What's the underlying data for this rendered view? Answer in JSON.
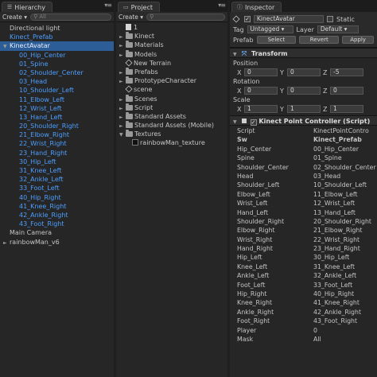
{
  "hierarchy": {
    "tab_label": "Hierarchy",
    "create_label": "Create",
    "search_placeholder": "All",
    "items": [
      {
        "label": "Directional light",
        "indent": 0,
        "blue": false,
        "arrow": ""
      },
      {
        "label": "Kinect_Prefab",
        "indent": 0,
        "blue": true,
        "arrow": ""
      },
      {
        "label": "KinectAvatar",
        "indent": 0,
        "blue": false,
        "arrow": "▼",
        "selected": true
      },
      {
        "label": "00_Hip_Center",
        "indent": 2,
        "blue": true,
        "arrow": ""
      },
      {
        "label": "01_Spine",
        "indent": 2,
        "blue": true,
        "arrow": ""
      },
      {
        "label": "02_Shoulder_Center",
        "indent": 2,
        "blue": true,
        "arrow": ""
      },
      {
        "label": "03_Head",
        "indent": 2,
        "blue": true,
        "arrow": ""
      },
      {
        "label": "10_Shoulder_Left",
        "indent": 2,
        "blue": true,
        "arrow": ""
      },
      {
        "label": "11_Elbow_Left",
        "indent": 2,
        "blue": true,
        "arrow": ""
      },
      {
        "label": "12_Wrist_Left",
        "indent": 2,
        "blue": true,
        "arrow": ""
      },
      {
        "label": "13_Hand_Left",
        "indent": 2,
        "blue": true,
        "arrow": ""
      },
      {
        "label": "20_Shoulder_Right",
        "indent": 2,
        "blue": true,
        "arrow": ""
      },
      {
        "label": "21_Elbow_Right",
        "indent": 2,
        "blue": true,
        "arrow": ""
      },
      {
        "label": "22_Wrist_Right",
        "indent": 2,
        "blue": true,
        "arrow": ""
      },
      {
        "label": "23_Hand_Right",
        "indent": 2,
        "blue": true,
        "arrow": ""
      },
      {
        "label": "30_Hip_Left",
        "indent": 2,
        "blue": true,
        "arrow": ""
      },
      {
        "label": "31_Knee_Left",
        "indent": 2,
        "blue": true,
        "arrow": ""
      },
      {
        "label": "32_Ankle_Left",
        "indent": 2,
        "blue": true,
        "arrow": ""
      },
      {
        "label": "33_Foot_Left",
        "indent": 2,
        "blue": true,
        "arrow": ""
      },
      {
        "label": "40_Hip_Right",
        "indent": 2,
        "blue": true,
        "arrow": ""
      },
      {
        "label": "41_Knee_Right",
        "indent": 2,
        "blue": true,
        "arrow": ""
      },
      {
        "label": "42_Ankle_Right",
        "indent": 2,
        "blue": true,
        "arrow": ""
      },
      {
        "label": "43_Foot_Right",
        "indent": 2,
        "blue": true,
        "arrow": ""
      },
      {
        "label": "Main Camera",
        "indent": 0,
        "blue": false,
        "arrow": ""
      },
      {
        "label": "rainbowMan_v6",
        "indent": 0,
        "blue": false,
        "arrow": "►"
      }
    ]
  },
  "project": {
    "tab_label": "Project",
    "create_label": "Create",
    "search_placeholder": "",
    "items": [
      {
        "label": "1",
        "kind": "file",
        "indent": 0,
        "arrow": ""
      },
      {
        "label": "Kinect",
        "kind": "folder",
        "indent": 0,
        "arrow": "►"
      },
      {
        "label": "Materials",
        "kind": "folder",
        "indent": 0,
        "arrow": "►"
      },
      {
        "label": "Models",
        "kind": "folder",
        "indent": 0,
        "arrow": "►"
      },
      {
        "label": "New Terrain",
        "kind": "prefab",
        "indent": 0,
        "arrow": ""
      },
      {
        "label": "Prefabs",
        "kind": "folder",
        "indent": 0,
        "arrow": "►"
      },
      {
        "label": "PrototypeCharacter",
        "kind": "folder",
        "indent": 0,
        "arrow": "►"
      },
      {
        "label": "scene",
        "kind": "prefab",
        "indent": 0,
        "arrow": ""
      },
      {
        "label": "Scenes",
        "kind": "folder",
        "indent": 0,
        "arrow": "►"
      },
      {
        "label": "Script",
        "kind": "folder",
        "indent": 0,
        "arrow": "►"
      },
      {
        "label": "Standard Assets",
        "kind": "folder",
        "indent": 0,
        "arrow": "►"
      },
      {
        "label": "Standard Assets (Mobile)",
        "kind": "folder",
        "indent": 0,
        "arrow": "►"
      },
      {
        "label": "Textures",
        "kind": "folder",
        "indent": 0,
        "arrow": "▼"
      },
      {
        "label": "rainbowMan_texture",
        "kind": "texture",
        "indent": 1,
        "arrow": ""
      }
    ]
  },
  "inspector": {
    "tab_label": "Inspector",
    "object_name": "KinectAvatar",
    "static_label": "Static",
    "tag_label": "Tag",
    "tag_value": "Untagged",
    "layer_label": "Layer",
    "layer_value": "Default",
    "prefab_label": "Prefab",
    "select_label": "Select",
    "revert_label": "Revert",
    "apply_label": "Apply",
    "transform": {
      "title": "Transform",
      "position_label": "Position",
      "position": {
        "x": "0",
        "y": "0",
        "z": "-5"
      },
      "rotation_label": "Rotation",
      "rotation": {
        "x": "0",
        "y": "0",
        "z": "0"
      },
      "scale_label": "Scale",
      "scale": {
        "x": "1",
        "y": "1",
        "z": "1"
      }
    },
    "script_component": {
      "title": "Kinect Point Controller (Script)",
      "rows": [
        {
          "label": "Script",
          "value": "KinectPointContro"
        },
        {
          "label": "Sw",
          "value": "Kinect_Prefab"
        },
        {
          "label": "Hip_Center",
          "value": "00_Hip_Center"
        },
        {
          "label": "Spine",
          "value": "01_Spine"
        },
        {
          "label": "Shoulder_Center",
          "value": "02_Shoulder_Center"
        },
        {
          "label": "Head",
          "value": "03_Head"
        },
        {
          "label": "Shoulder_Left",
          "value": "10_Shoulder_Left"
        },
        {
          "label": "Elbow_Left",
          "value": "11_Elbow_Left"
        },
        {
          "label": "Wrist_Left",
          "value": "12_Wrist_Left"
        },
        {
          "label": "Hand_Left",
          "value": "13_Hand_Left"
        },
        {
          "label": "Shoulder_Right",
          "value": "20_Shoulder_Right"
        },
        {
          "label": "Elbow_Right",
          "value": "21_Elbow_Right"
        },
        {
          "label": "Wrist_Right",
          "value": "22_Wrist_Right"
        },
        {
          "label": "Hand_Right",
          "value": "23_Hand_Right"
        },
        {
          "label": "Hip_Left",
          "value": "30_Hip_Left"
        },
        {
          "label": "Knee_Left",
          "value": "31_Knee_Left"
        },
        {
          "label": "Ankle_Left",
          "value": "32_Ankle_Left"
        },
        {
          "label": "Foot_Left",
          "value": "33_Foot_Left"
        },
        {
          "label": "Hip_Right",
          "value": "40_Hip_Right"
        },
        {
          "label": "Knee_Right",
          "value": "41_Knee_Right"
        },
        {
          "label": "Ankle_Right",
          "value": "42_Ankle_Right"
        },
        {
          "label": "Foot_Right",
          "value": "43_Foot_Right"
        },
        {
          "label": "Player",
          "value": "0"
        },
        {
          "label": "Mask",
          "value": "All"
        }
      ]
    }
  },
  "colors": {
    "selection": "#2c5d96",
    "prefab_text": "#4d9fff",
    "background": "#262626"
  }
}
